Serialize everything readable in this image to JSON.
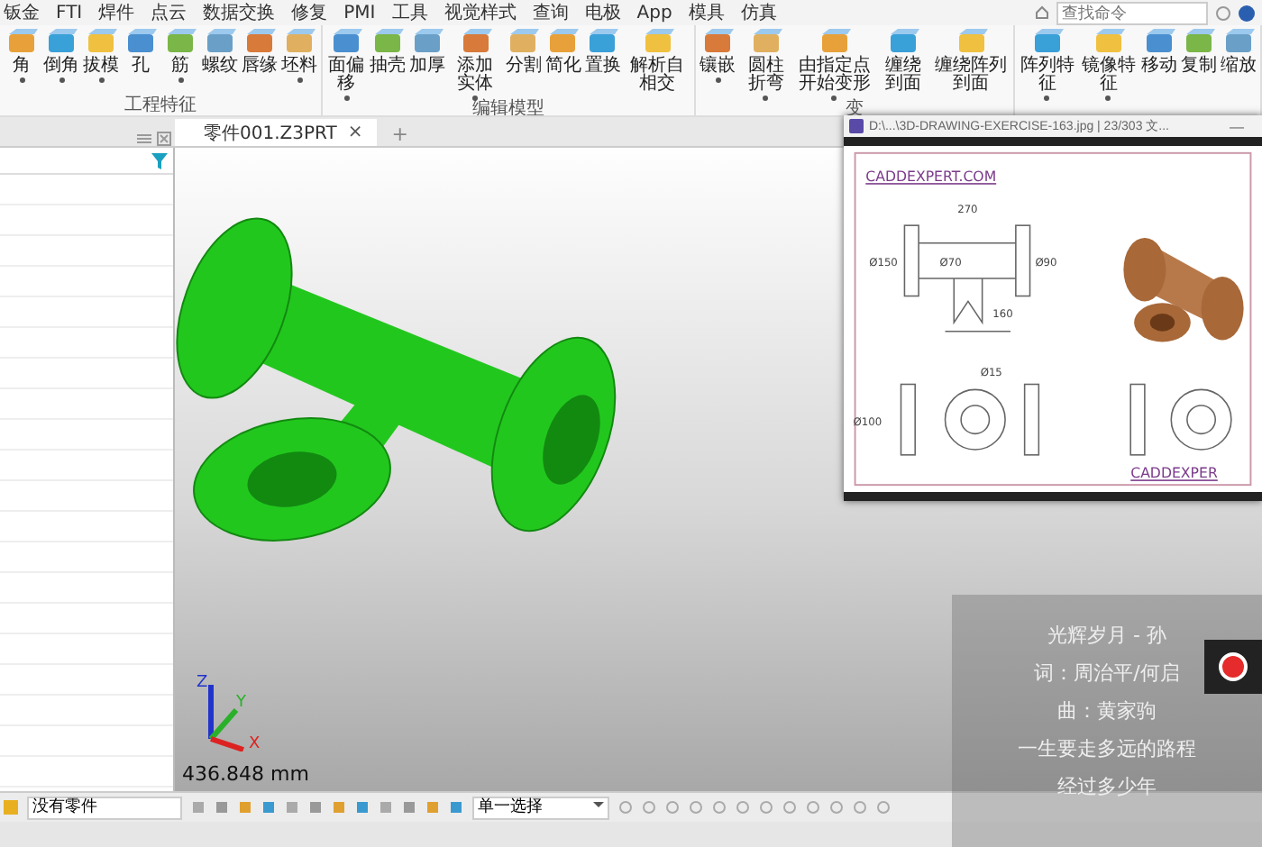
{
  "menu": {
    "items": [
      "钣金",
      "FTI",
      "焊件",
      "点云",
      "数据交换",
      "修复",
      "PMI",
      "工具",
      "视觉样式",
      "查询",
      "电极",
      "App",
      "模具",
      "仿真"
    ]
  },
  "search": {
    "placeholder": "查找命令"
  },
  "ribbon": {
    "groups": [
      {
        "label": "工程特征",
        "buttons": [
          {
            "label": "角",
            "dropdown": true
          },
          {
            "label": "倒角",
            "dropdown": true
          },
          {
            "label": "拔模",
            "dropdown": true
          },
          {
            "label": "孔",
            "dropdown": false
          },
          {
            "label": "筋",
            "dropdown": true
          },
          {
            "label": "螺纹",
            "dropdown": false
          },
          {
            "label": "唇缘",
            "dropdown": false
          },
          {
            "label": "坯料",
            "dropdown": true
          }
        ]
      },
      {
        "label": "编辑模型",
        "buttons": [
          {
            "label": "面偏移",
            "dropdown": true
          },
          {
            "label": "抽壳",
            "dropdown": false
          },
          {
            "label": "加厚",
            "dropdown": false
          },
          {
            "label": "添加实体",
            "dropdown": true
          },
          {
            "label": "分割",
            "dropdown": false
          },
          {
            "label": "简化",
            "dropdown": false
          },
          {
            "label": "置换",
            "dropdown": false
          },
          {
            "label": "解析自相交",
            "dropdown": false
          }
        ]
      },
      {
        "label": "变",
        "buttons": [
          {
            "label": "镶嵌",
            "dropdown": true
          },
          {
            "label": "圆柱折弯",
            "dropdown": true
          },
          {
            "label": "由指定点开始变形",
            "dropdown": true
          },
          {
            "label": "缠绕到面",
            "dropdown": false
          },
          {
            "label": "缠绕阵列到面",
            "dropdown": false
          }
        ]
      },
      {
        "buttons": [
          {
            "label": "阵列特征",
            "dropdown": true
          },
          {
            "label": "镜像特征",
            "dropdown": true
          },
          {
            "label": "移动",
            "dropdown": false
          },
          {
            "label": "复制",
            "dropdown": false
          },
          {
            "label": "缩放",
            "dropdown": false
          }
        ]
      }
    ]
  },
  "tabs": [
    {
      "label": "零件001.Z3PRT",
      "selected": true,
      "close": "×"
    }
  ],
  "new_tab": "+",
  "viewport": {
    "scale_readout": "436.848 mm",
    "axes": [
      "Z",
      "Y",
      "X"
    ]
  },
  "image_viewer": {
    "title": "D:\\...\\3D-DRAWING-EXERCISE-163.jpg  |  23/303 文...",
    "minimize": "—",
    "drawing_texts": {
      "header": "CADDEXPERT.COM",
      "footer": "CADDEXPER",
      "dims": [
        "270",
        "Ø150",
        "Ø70",
        "Ø90",
        "160",
        "Ø100",
        "Ø15"
      ]
    }
  },
  "lyrics": [
    "光辉岁月 - 孙",
    "词：周治平/何启",
    "曲：黄家驹",
    "一生要走多远的路程",
    "经过多少年"
  ],
  "bottom_bar": {
    "part_field": "没有零件",
    "filter_select": "单一选择"
  }
}
